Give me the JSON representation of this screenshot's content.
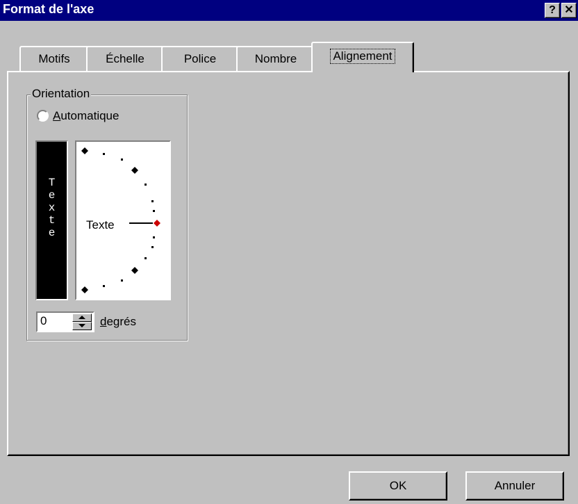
{
  "window": {
    "title": "Format de l'axe",
    "help_label": "?",
    "close_label": "✕"
  },
  "tabs": [
    {
      "label": "Motifs"
    },
    {
      "label": "Échelle"
    },
    {
      "label": "Police"
    },
    {
      "label": "Nombre"
    },
    {
      "label": "Alignement",
      "selected": true
    }
  ],
  "orientation": {
    "group_label": "Orientation",
    "radio_label_accel": "A",
    "radio_label_rest": "utomatique",
    "radio_checked": false,
    "vertical_text": [
      "T",
      "e",
      "x",
      "t",
      "e"
    ],
    "dial_text": "Texte",
    "degrees_value": "0",
    "degrees_label_accel": "d",
    "degrees_label_rest": "egrés",
    "accent_color": "#cc0000"
  },
  "buttons": {
    "ok_label": "OK",
    "cancel_label": "Annuler"
  }
}
